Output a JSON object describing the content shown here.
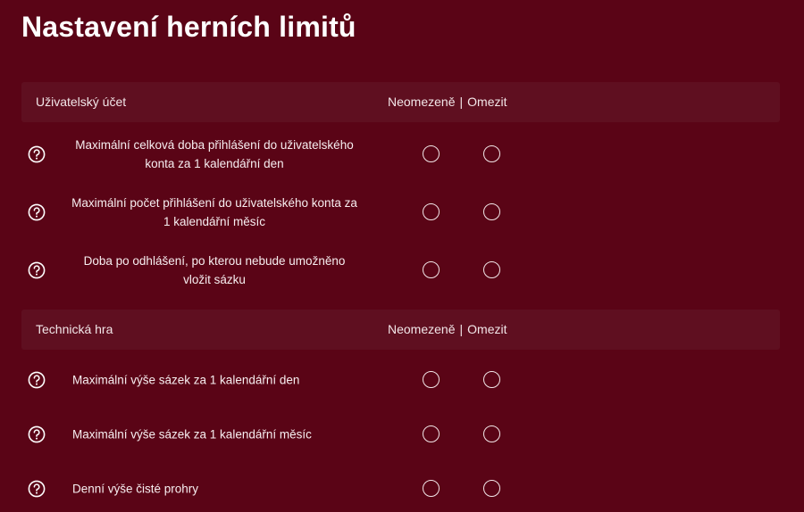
{
  "page": {
    "title": "Nastavení herních limitů"
  },
  "colors": {
    "background": "#5a0416",
    "section_header_bg": "#5f0f20",
    "text": "#ffffff"
  },
  "columns": {
    "unlimited": "Neomezeně",
    "separator": "|",
    "limit": "Omezit"
  },
  "sections": [
    {
      "title": "Uživatelský účet",
      "rows": [
        {
          "label": "Maximální celková doba přihlášení do uživatelského konta za 1 kalendářní den",
          "icon": "question-circle-icon",
          "selected": null
        },
        {
          "label": "Maximální počet přihlášení do uživatelského konta za 1 kalendářní měsíc",
          "icon": "question-circle-icon",
          "selected": null
        },
        {
          "label": "Doba po odhlášení, po kterou nebude umožněno vložit sázku",
          "icon": "question-circle-icon",
          "selected": null
        }
      ]
    },
    {
      "title": "Technická hra",
      "rows": [
        {
          "label": "Maximální výše sázek za 1 kalendářní den",
          "icon": "question-circle-icon",
          "selected": null
        },
        {
          "label": "Maximální výše sázek za 1 kalendářní měsíc",
          "icon": "question-circle-icon",
          "selected": null
        },
        {
          "label": "Denní výše čisté prohry",
          "icon": "question-circle-icon",
          "selected": null
        }
      ]
    }
  ]
}
